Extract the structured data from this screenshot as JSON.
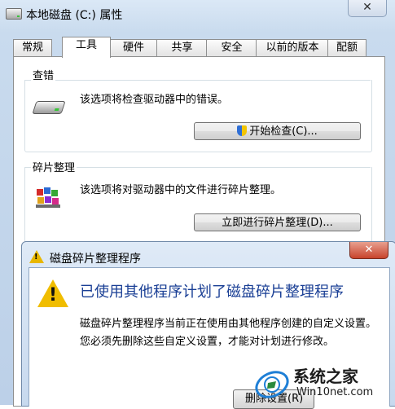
{
  "window": {
    "title": "本地磁盘 (C:) 属性",
    "close_glyph": "✕"
  },
  "tabs": [
    "常规",
    "工具",
    "硬件",
    "共享",
    "安全",
    "以前的版本",
    "配额"
  ],
  "active_tab": "工具",
  "error_check": {
    "title": "查错",
    "description": "该选项将检查驱动器中的错误。",
    "button_label": "开始检查(C)...",
    "icon": "hard-drive-icon"
  },
  "defrag": {
    "title": "碎片整理",
    "description": "该选项将对驱动器中的文件进行碎片整理。",
    "button_label": "立即进行碎片整理(D)...",
    "icon": "defrag-icon"
  },
  "dialog": {
    "title": "磁盘碎片整理程序",
    "close_glyph": "✕",
    "heading": "已使用其他程序计划了磁盘碎片整理程序",
    "message": "磁盘碎片整理程序当前正在使用由其他程序创建的自定义设置。您必须先删除这些自定义设置，才能对计划进行修改。",
    "button_label": "删除设置(R)",
    "icon": "warning-icon"
  },
  "watermark": {
    "name": "系统之家",
    "url": "Win10net.com"
  },
  "colors": {
    "dialog_heading": "#1a3f95",
    "warning": "#f0bd00",
    "close_red": "#c8432c"
  }
}
